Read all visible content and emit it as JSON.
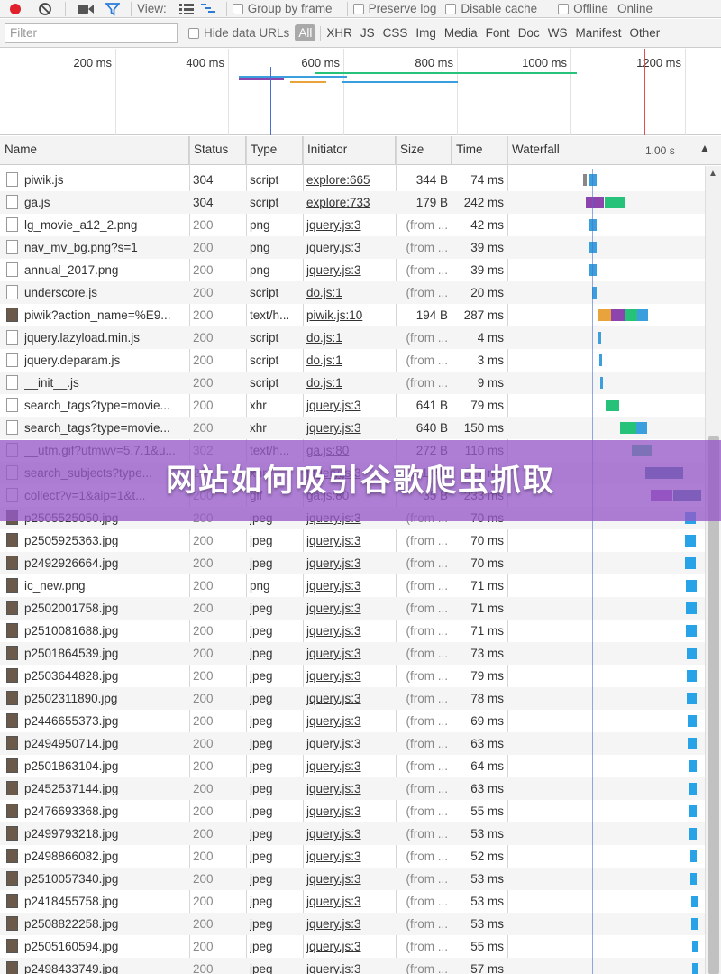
{
  "toolbar": {
    "view_label": "View:",
    "group_by_frame": "Group by frame",
    "preserve_log": "Preserve log",
    "disable_cache": "Disable cache",
    "offline": "Offline",
    "online": "Online"
  },
  "filterbar": {
    "placeholder": "Filter",
    "hide_data_urls": "Hide data URLs",
    "types": [
      "All",
      "XHR",
      "JS",
      "CSS",
      "Img",
      "Media",
      "Font",
      "Doc",
      "WS",
      "Manifest",
      "Other"
    ]
  },
  "overview": {
    "ticks": [
      "200 ms",
      "400 ms",
      "600 ms",
      "800 ms",
      "1000 ms",
      "1200 ms"
    ]
  },
  "columns": {
    "name": "Name",
    "status": "Status",
    "type": "Type",
    "initiator": "Initiator",
    "size": "Size",
    "time": "Time",
    "waterfall": "Waterfall",
    "waterfall_scale": "1.00 s"
  },
  "rows": [
    {
      "name": "piwik.js",
      "status": "304",
      "type": "script",
      "initiator": "explore:665",
      "size": "344 B",
      "time": "74 ms",
      "icon": "file",
      "wf": [
        [
          647,
          4,
          "#888"
        ],
        [
          654,
          8,
          "#3a9fdc"
        ]
      ]
    },
    {
      "name": "ga.js",
      "status": "304",
      "type": "script",
      "initiator": "explore:733",
      "size": "179 B",
      "time": "242 ms",
      "icon": "file",
      "wf": [
        [
          650,
          20,
          "#8e44ad"
        ],
        [
          671,
          22,
          "#27c27a"
        ]
      ]
    },
    {
      "name": "lg_movie_a12_2.png",
      "status": "200",
      "type": "png",
      "initiator": "jquery.js:3",
      "size": "(from ...",
      "time": "42 ms",
      "icon": "file",
      "wf": [
        [
          653,
          9,
          "#3a9fdc"
        ]
      ]
    },
    {
      "name": "nav_mv_bg.png?s=1",
      "status": "200",
      "type": "png",
      "initiator": "jquery.js:3",
      "size": "(from ...",
      "time": "39 ms",
      "icon": "file",
      "wf": [
        [
          653,
          9,
          "#3a9fdc"
        ]
      ]
    },
    {
      "name": "annual_2017.png",
      "status": "200",
      "type": "png",
      "initiator": "jquery.js:3",
      "size": "(from ...",
      "time": "39 ms",
      "icon": "file",
      "wf": [
        [
          653,
          9,
          "#3a9fdc"
        ]
      ]
    },
    {
      "name": "underscore.js",
      "status": "200",
      "type": "script",
      "initiator": "do.js:1",
      "size": "(from ...",
      "time": "20 ms",
      "icon": "file",
      "wf": [
        [
          657,
          5,
          "#3a9fdc"
        ]
      ]
    },
    {
      "name": "piwik?action_name=%E9...",
      "status": "200",
      "type": "text/h...",
      "initiator": "piwik.js:10",
      "size": "194 B",
      "time": "287 ms",
      "icon": "img",
      "wf": [
        [
          664,
          14,
          "#e8a33d"
        ],
        [
          678,
          15,
          "#8e44ad"
        ],
        [
          694,
          25,
          "#27c27a"
        ],
        [
          707,
          12,
          "#3a9fdc"
        ]
      ]
    },
    {
      "name": "jquery.lazyload.min.js",
      "status": "200",
      "type": "script",
      "initiator": "do.js:1",
      "size": "(from ...",
      "time": "4 ms",
      "icon": "file",
      "wf": [
        [
          664,
          3,
          "#3a9fdc"
        ]
      ]
    },
    {
      "name": "jquery.deparam.js",
      "status": "200",
      "type": "script",
      "initiator": "do.js:1",
      "size": "(from ...",
      "time": "3 ms",
      "icon": "file",
      "wf": [
        [
          665,
          3,
          "#3a9fdc"
        ]
      ]
    },
    {
      "name": "__init__.js",
      "status": "200",
      "type": "script",
      "initiator": "do.js:1",
      "size": "(from ...",
      "time": "9 ms",
      "icon": "file",
      "wf": [
        [
          666,
          3,
          "#3a9fdc"
        ]
      ]
    },
    {
      "name": "search_tags?type=movie...",
      "status": "200",
      "type": "xhr",
      "initiator": "jquery.js:3",
      "size": "641 B",
      "time": "79 ms",
      "icon": "file",
      "wf": [
        [
          672,
          15,
          "#27c27a"
        ]
      ]
    },
    {
      "name": "search_tags?type=movie...",
      "status": "200",
      "type": "xhr",
      "initiator": "jquery.js:3",
      "size": "640 B",
      "time": "150 ms",
      "icon": "file",
      "wf": [
        [
          688,
          20,
          "#27c27a"
        ],
        [
          706,
          12,
          "#3a9fdc"
        ]
      ]
    },
    {
      "name": "__utm.gif?utmwv=5.7.1&u...",
      "status": "302",
      "type": "text/h...",
      "initiator": "ga.js:80",
      "size": "272 B",
      "time": "110 ms",
      "icon": "file",
      "wf": [
        [
          701,
          22,
          "#27c27a"
        ]
      ]
    },
    {
      "name": "search_subjects?type...",
      "status": "200",
      "type": "xhr",
      "initiator": "jquery.js:3",
      "size": "5.1 KB",
      "time": "317 ms",
      "icon": "file",
      "wf": [
        [
          716,
          42,
          "#2b6f87"
        ]
      ]
    },
    {
      "name": "collect?v=1&aip=1&t...",
      "status": "200",
      "type": "gif",
      "initiator": "ga.js:80",
      "size": "35 B",
      "time": "233 ms",
      "icon": "file",
      "wf": [
        [
          722,
          24,
          "#8e44ad"
        ],
        [
          747,
          31,
          "#2b6f87"
        ]
      ]
    },
    {
      "name": "p2505525050.jpg",
      "status": "200",
      "type": "jpeg",
      "initiator": "jquery.js:3",
      "size": "(from ...",
      "time": "70 ms",
      "icon": "img",
      "wf": [
        [
          760,
          12,
          "#29a3e8"
        ]
      ]
    },
    {
      "name": "p2505925363.jpg",
      "status": "200",
      "type": "jpeg",
      "initiator": "jquery.js:3",
      "size": "(from ...",
      "time": "70 ms",
      "icon": "img",
      "wf": [
        [
          760,
          12,
          "#29a3e8"
        ]
      ]
    },
    {
      "name": "p2492926664.jpg",
      "status": "200",
      "type": "jpeg",
      "initiator": "jquery.js:3",
      "size": "(from ...",
      "time": "70 ms",
      "icon": "img",
      "wf": [
        [
          760,
          12,
          "#29a3e8"
        ]
      ]
    },
    {
      "name": "ic_new.png",
      "status": "200",
      "type": "png",
      "initiator": "jquery.js:3",
      "size": "(from ...",
      "time": "71 ms",
      "icon": "img",
      "wf": [
        [
          761,
          12,
          "#29a3e8"
        ]
      ]
    },
    {
      "name": "p2502001758.jpg",
      "status": "200",
      "type": "jpeg",
      "initiator": "jquery.js:3",
      "size": "(from ...",
      "time": "71 ms",
      "icon": "img",
      "wf": [
        [
          761,
          12,
          "#29a3e8"
        ]
      ]
    },
    {
      "name": "p2510081688.jpg",
      "status": "200",
      "type": "jpeg",
      "initiator": "jquery.js:3",
      "size": "(from ...",
      "time": "71 ms",
      "icon": "img",
      "wf": [
        [
          761,
          12,
          "#29a3e8"
        ]
      ]
    },
    {
      "name": "p2501864539.jpg",
      "status": "200",
      "type": "jpeg",
      "initiator": "jquery.js:3",
      "size": "(from ...",
      "time": "73 ms",
      "icon": "img",
      "wf": [
        [
          762,
          11,
          "#29a3e8"
        ]
      ]
    },
    {
      "name": "p2503644828.jpg",
      "status": "200",
      "type": "jpeg",
      "initiator": "jquery.js:3",
      "size": "(from ...",
      "time": "79 ms",
      "icon": "img",
      "wf": [
        [
          762,
          11,
          "#29a3e8"
        ]
      ]
    },
    {
      "name": "p2502311890.jpg",
      "status": "200",
      "type": "jpeg",
      "initiator": "jquery.js:3",
      "size": "(from ...",
      "time": "78 ms",
      "icon": "img",
      "wf": [
        [
          762,
          11,
          "#29a3e8"
        ]
      ]
    },
    {
      "name": "p2446655373.jpg",
      "status": "200",
      "type": "jpeg",
      "initiator": "jquery.js:3",
      "size": "(from ...",
      "time": "69 ms",
      "icon": "img",
      "wf": [
        [
          763,
          10,
          "#29a3e8"
        ]
      ]
    },
    {
      "name": "p2494950714.jpg",
      "status": "200",
      "type": "jpeg",
      "initiator": "jquery.js:3",
      "size": "(from ...",
      "time": "63 ms",
      "icon": "img",
      "wf": [
        [
          763,
          10,
          "#29a3e8"
        ]
      ]
    },
    {
      "name": "p2501863104.jpg",
      "status": "200",
      "type": "jpeg",
      "initiator": "jquery.js:3",
      "size": "(from ...",
      "time": "64 ms",
      "icon": "img",
      "wf": [
        [
          764,
          9,
          "#29a3e8"
        ]
      ]
    },
    {
      "name": "p2452537144.jpg",
      "status": "200",
      "type": "jpeg",
      "initiator": "jquery.js:3",
      "size": "(from ...",
      "time": "63 ms",
      "icon": "img",
      "wf": [
        [
          764,
          9,
          "#29a3e8"
        ]
      ]
    },
    {
      "name": "p2476693368.jpg",
      "status": "200",
      "type": "jpeg",
      "initiator": "jquery.js:3",
      "size": "(from ...",
      "time": "55 ms",
      "icon": "img",
      "wf": [
        [
          765,
          8,
          "#29a3e8"
        ]
      ]
    },
    {
      "name": "p2499793218.jpg",
      "status": "200",
      "type": "jpeg",
      "initiator": "jquery.js:3",
      "size": "(from ...",
      "time": "53 ms",
      "icon": "img",
      "wf": [
        [
          765,
          8,
          "#29a3e8"
        ]
      ]
    },
    {
      "name": "p2498866082.jpg",
      "status": "200",
      "type": "jpeg",
      "initiator": "jquery.js:3",
      "size": "(from ...",
      "time": "52 ms",
      "icon": "img",
      "wf": [
        [
          766,
          7,
          "#29a3e8"
        ]
      ]
    },
    {
      "name": "p2510057340.jpg",
      "status": "200",
      "type": "jpeg",
      "initiator": "jquery.js:3",
      "size": "(from ...",
      "time": "53 ms",
      "icon": "img",
      "wf": [
        [
          766,
          7,
          "#29a3e8"
        ]
      ]
    },
    {
      "name": "p2418455758.jpg",
      "status": "200",
      "type": "jpeg",
      "initiator": "jquery.js:3",
      "size": "(from ...",
      "time": "53 ms",
      "icon": "img",
      "wf": [
        [
          767,
          7,
          "#29a3e8"
        ]
      ]
    },
    {
      "name": "p2508822258.jpg",
      "status": "200",
      "type": "jpeg",
      "initiator": "jquery.js:3",
      "size": "(from ...",
      "time": "53 ms",
      "icon": "img",
      "wf": [
        [
          767,
          7,
          "#29a3e8"
        ]
      ]
    },
    {
      "name": "p2505160594.jpg",
      "status": "200",
      "type": "jpeg",
      "initiator": "jquery.js:3",
      "size": "(from ...",
      "time": "55 ms",
      "icon": "img",
      "wf": [
        [
          768,
          6,
          "#29a3e8"
        ]
      ]
    },
    {
      "name": "p2498433749.jpg",
      "status": "200",
      "type": "jpeg",
      "initiator": "jquery.js:3",
      "size": "(from ...",
      "time": "57 ms",
      "icon": "img",
      "wf": [
        [
          768,
          6,
          "#29a3e8"
        ]
      ]
    }
  ],
  "overlay": {
    "title": "网站如何吸引谷歌爬虫抓取"
  },
  "colors": {
    "record": "#e0202a",
    "filter_active": "#2a7bd8",
    "overlay": "#9a5ac8"
  }
}
